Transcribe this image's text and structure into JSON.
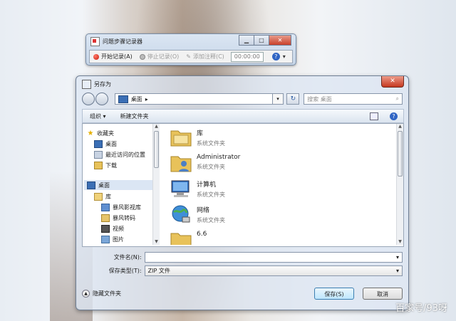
{
  "watermark": "百家号/93呀",
  "psr": {
    "title": "问题步骤记录器",
    "start_record": "开始记录(A)",
    "stop_record": "停止记录(O)",
    "add_comment": "添加注释(C)",
    "timer": "00:00:00"
  },
  "dialog": {
    "title": "另存为",
    "address": "桌面",
    "search_placeholder": "搜索 桌面",
    "toolbar": {
      "organize": "组织 ▾",
      "new_folder": "新建文件夹"
    },
    "tree": [
      {
        "label": "收藏夹",
        "icon": "star-icon"
      },
      {
        "label": "桌面",
        "icon": "desktop-icon"
      },
      {
        "label": "最近访问的位置",
        "icon": "recent-icon"
      },
      {
        "label": "下载",
        "icon": "download-icon"
      },
      {
        "label": "桌面",
        "icon": "desktop-icon"
      },
      {
        "label": "库",
        "icon": "library-icon"
      },
      {
        "label": "暴风影视库",
        "icon": "video-library-icon"
      },
      {
        "label": "暴风转码",
        "icon": "folder-icon"
      },
      {
        "label": "视频",
        "icon": "video-icon"
      },
      {
        "label": "图片",
        "icon": "picture-icon"
      }
    ],
    "files": [
      {
        "name": "库",
        "desc": "系统文件夹",
        "icon": "library-folder-icon"
      },
      {
        "name": "Administrator",
        "desc": "系统文件夹",
        "icon": "user-folder-icon"
      },
      {
        "name": "计算机",
        "desc": "系统文件夹",
        "icon": "computer-icon"
      },
      {
        "name": "网络",
        "desc": "系统文件夹",
        "icon": "network-icon"
      },
      {
        "name": "6.6",
        "desc": "",
        "icon": "folder-icon"
      }
    ],
    "filename_label": "文件名(N):",
    "filename_value": "",
    "filetype_label": "保存类型(T):",
    "filetype_value": "ZIP 文件",
    "hide_folders": "隐藏文件夹",
    "save": "保存(S)",
    "cancel": "取消"
  }
}
